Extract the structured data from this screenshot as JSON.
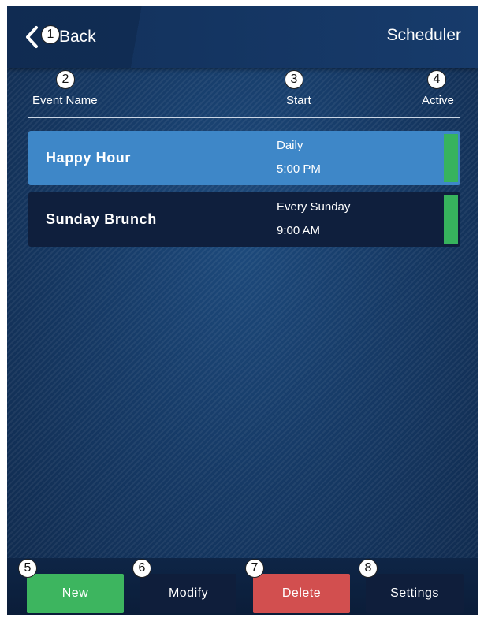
{
  "header": {
    "back_label": "Back",
    "title": "Scheduler",
    "back_icon": "chevron-left-icon"
  },
  "callouts": [
    "1",
    "2",
    "3",
    "4",
    "5",
    "6",
    "7",
    "8"
  ],
  "columns": {
    "name": "Event Name",
    "start": "Start",
    "active": "Active"
  },
  "events": [
    {
      "name": "Happy Hour",
      "recurrence": "Daily",
      "time": "5:00 PM",
      "active": true,
      "selected": true
    },
    {
      "name": "Sunday Brunch",
      "recurrence": "Every Sunday",
      "time": "9:00 AM",
      "active": true,
      "selected": false
    }
  ],
  "buttons": {
    "new": "New",
    "modify": "Modify",
    "delete": "Delete",
    "settings": "Settings"
  },
  "colors": {
    "selected_row": "#3e87c8",
    "row": "#0f1f3d",
    "active_indicator": "#37b35d",
    "new_button": "#3db55f",
    "delete_button": "#d24f4f"
  }
}
